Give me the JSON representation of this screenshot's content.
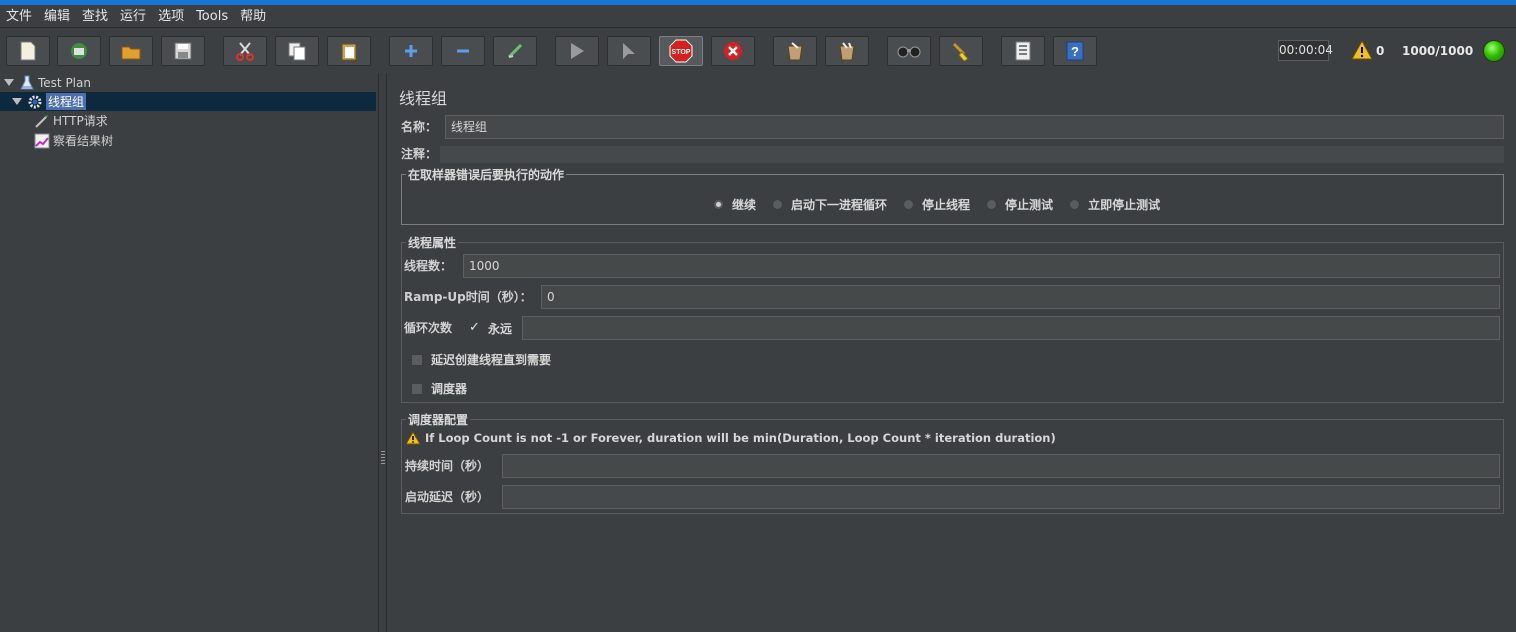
{
  "menu": [
    "文件",
    "编辑",
    "查找",
    "运行",
    "选项",
    "Tools",
    "帮助"
  ],
  "toolbar": {
    "buttons": [
      "new-icon",
      "templates-icon",
      "open-icon",
      "save-icon",
      "cut-icon",
      "copy-icon",
      "paste-icon",
      "expand-icon",
      "collapse-icon",
      "toggle-icon",
      "start-icon",
      "start-no-pauses-icon",
      "stop-icon",
      "shutdown-icon",
      "clear-icon",
      "clear-all-icon",
      "search-icon",
      "reset-search-icon",
      "function-helper-icon",
      "help-icon"
    ],
    "stop_text": "STOP"
  },
  "status": {
    "timer": "00:00:04",
    "warning_count": "0",
    "threads": "1000/1000"
  },
  "tree": {
    "root": "Test Plan",
    "thread_group": "线程组",
    "http_request": "HTTP请求",
    "result_tree": "察看结果树"
  },
  "main": {
    "title": "线程组",
    "name_label": "名称：",
    "name_value": "线程组",
    "comment_label": "注释：",
    "comment_value": "",
    "error_action": {
      "title": "在取样器错误后要执行的动作",
      "options": [
        "继续",
        "启动下一进程循环",
        "停止线程",
        "停止测试",
        "立即停止测试"
      ],
      "selected": 0
    },
    "thread_props": {
      "title": "线程属性",
      "threads_label": "线程数：",
      "threads_value": "1000",
      "rampup_label": "Ramp-Up时间（秒）：",
      "rampup_value": "0",
      "loop_label": "循环次数",
      "forever_label": "永远",
      "forever_checked": true,
      "loop_value": "",
      "delay_label": "延迟创建线程直到需要",
      "scheduler_label": "调度器"
    },
    "scheduler_config": {
      "title": "调度器配置",
      "warning": "If Loop Count is not -1 or Forever, duration will be min(Duration, Loop Count * iteration duration)",
      "duration_label": "持续时间（秒）",
      "duration_value": "",
      "startup_delay_label": "启动延迟（秒）",
      "startup_delay_value": ""
    }
  }
}
